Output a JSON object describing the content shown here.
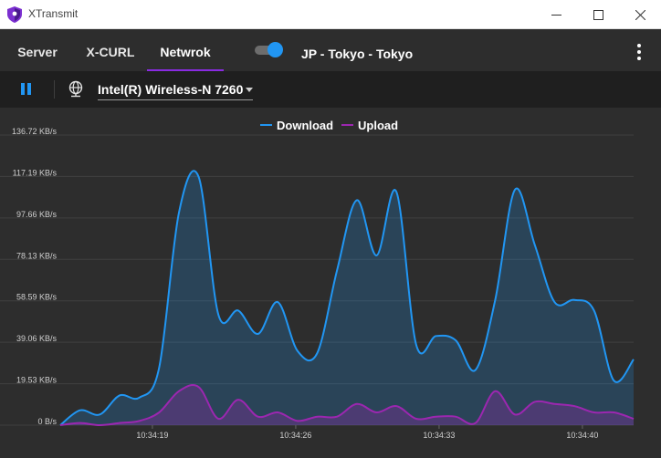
{
  "window": {
    "title": "XTransmit",
    "icons": {
      "app": "shield-logo-icon",
      "minimize": "minimize-icon",
      "maximize": "maximize-icon",
      "close": "close-icon"
    }
  },
  "tabs": [
    {
      "label": "Server",
      "active": false
    },
    {
      "label": "X-CURL",
      "active": false
    },
    {
      "label": "Netwrok",
      "active": true
    }
  ],
  "connection": {
    "toggle_on": true,
    "server_name": "JP - Tokyo - Tokyo"
  },
  "toolbar": {
    "pause_icon": "pause-icon",
    "network_icon": "globe-network-icon",
    "adapter": "Intel(R) Wireless-N 7260"
  },
  "colors": {
    "download": "#2196f3",
    "upload": "#9c27b0",
    "accent": "#8a2be2"
  },
  "chart_data": {
    "type": "area",
    "legend": [
      "Download",
      "Upload"
    ],
    "legend_position": "top",
    "grid": true,
    "ylim": [
      0,
      136.72
    ],
    "y_ticks": [
      "136.72 KB/s",
      "117.19 KB/s",
      "97.66 KB/s",
      "78.13 KB/s",
      "58.59 KB/s",
      "39.06 KB/s",
      "19.53 KB/s",
      "0 B/s"
    ],
    "x_ticks": [
      {
        "label": "10:34:19",
        "t": 4.5
      },
      {
        "label": "10:34:26",
        "t": 11.5
      },
      {
        "label": "10:34:33",
        "t": 18.5
      },
      {
        "label": "10:34:40",
        "t": 25.5
      }
    ],
    "t_range": [
      0,
      28
    ],
    "series": [
      {
        "name": "Download",
        "values": [
          0,
          7,
          5,
          14,
          13,
          27,
          100,
          117,
          52,
          54,
          43,
          58,
          35,
          34,
          73,
          106,
          80,
          110,
          38,
          42,
          40,
          26,
          59,
          111,
          85,
          58,
          59,
          54,
          21,
          31
        ]
      },
      {
        "name": "Upload",
        "values": [
          0,
          1,
          0,
          1,
          2,
          6,
          16,
          18,
          3,
          12,
          4,
          6,
          2,
          4,
          4,
          10,
          6,
          9,
          3,
          4,
          4,
          1,
          16,
          5,
          11,
          10,
          9,
          6,
          6,
          3
        ]
      }
    ]
  }
}
